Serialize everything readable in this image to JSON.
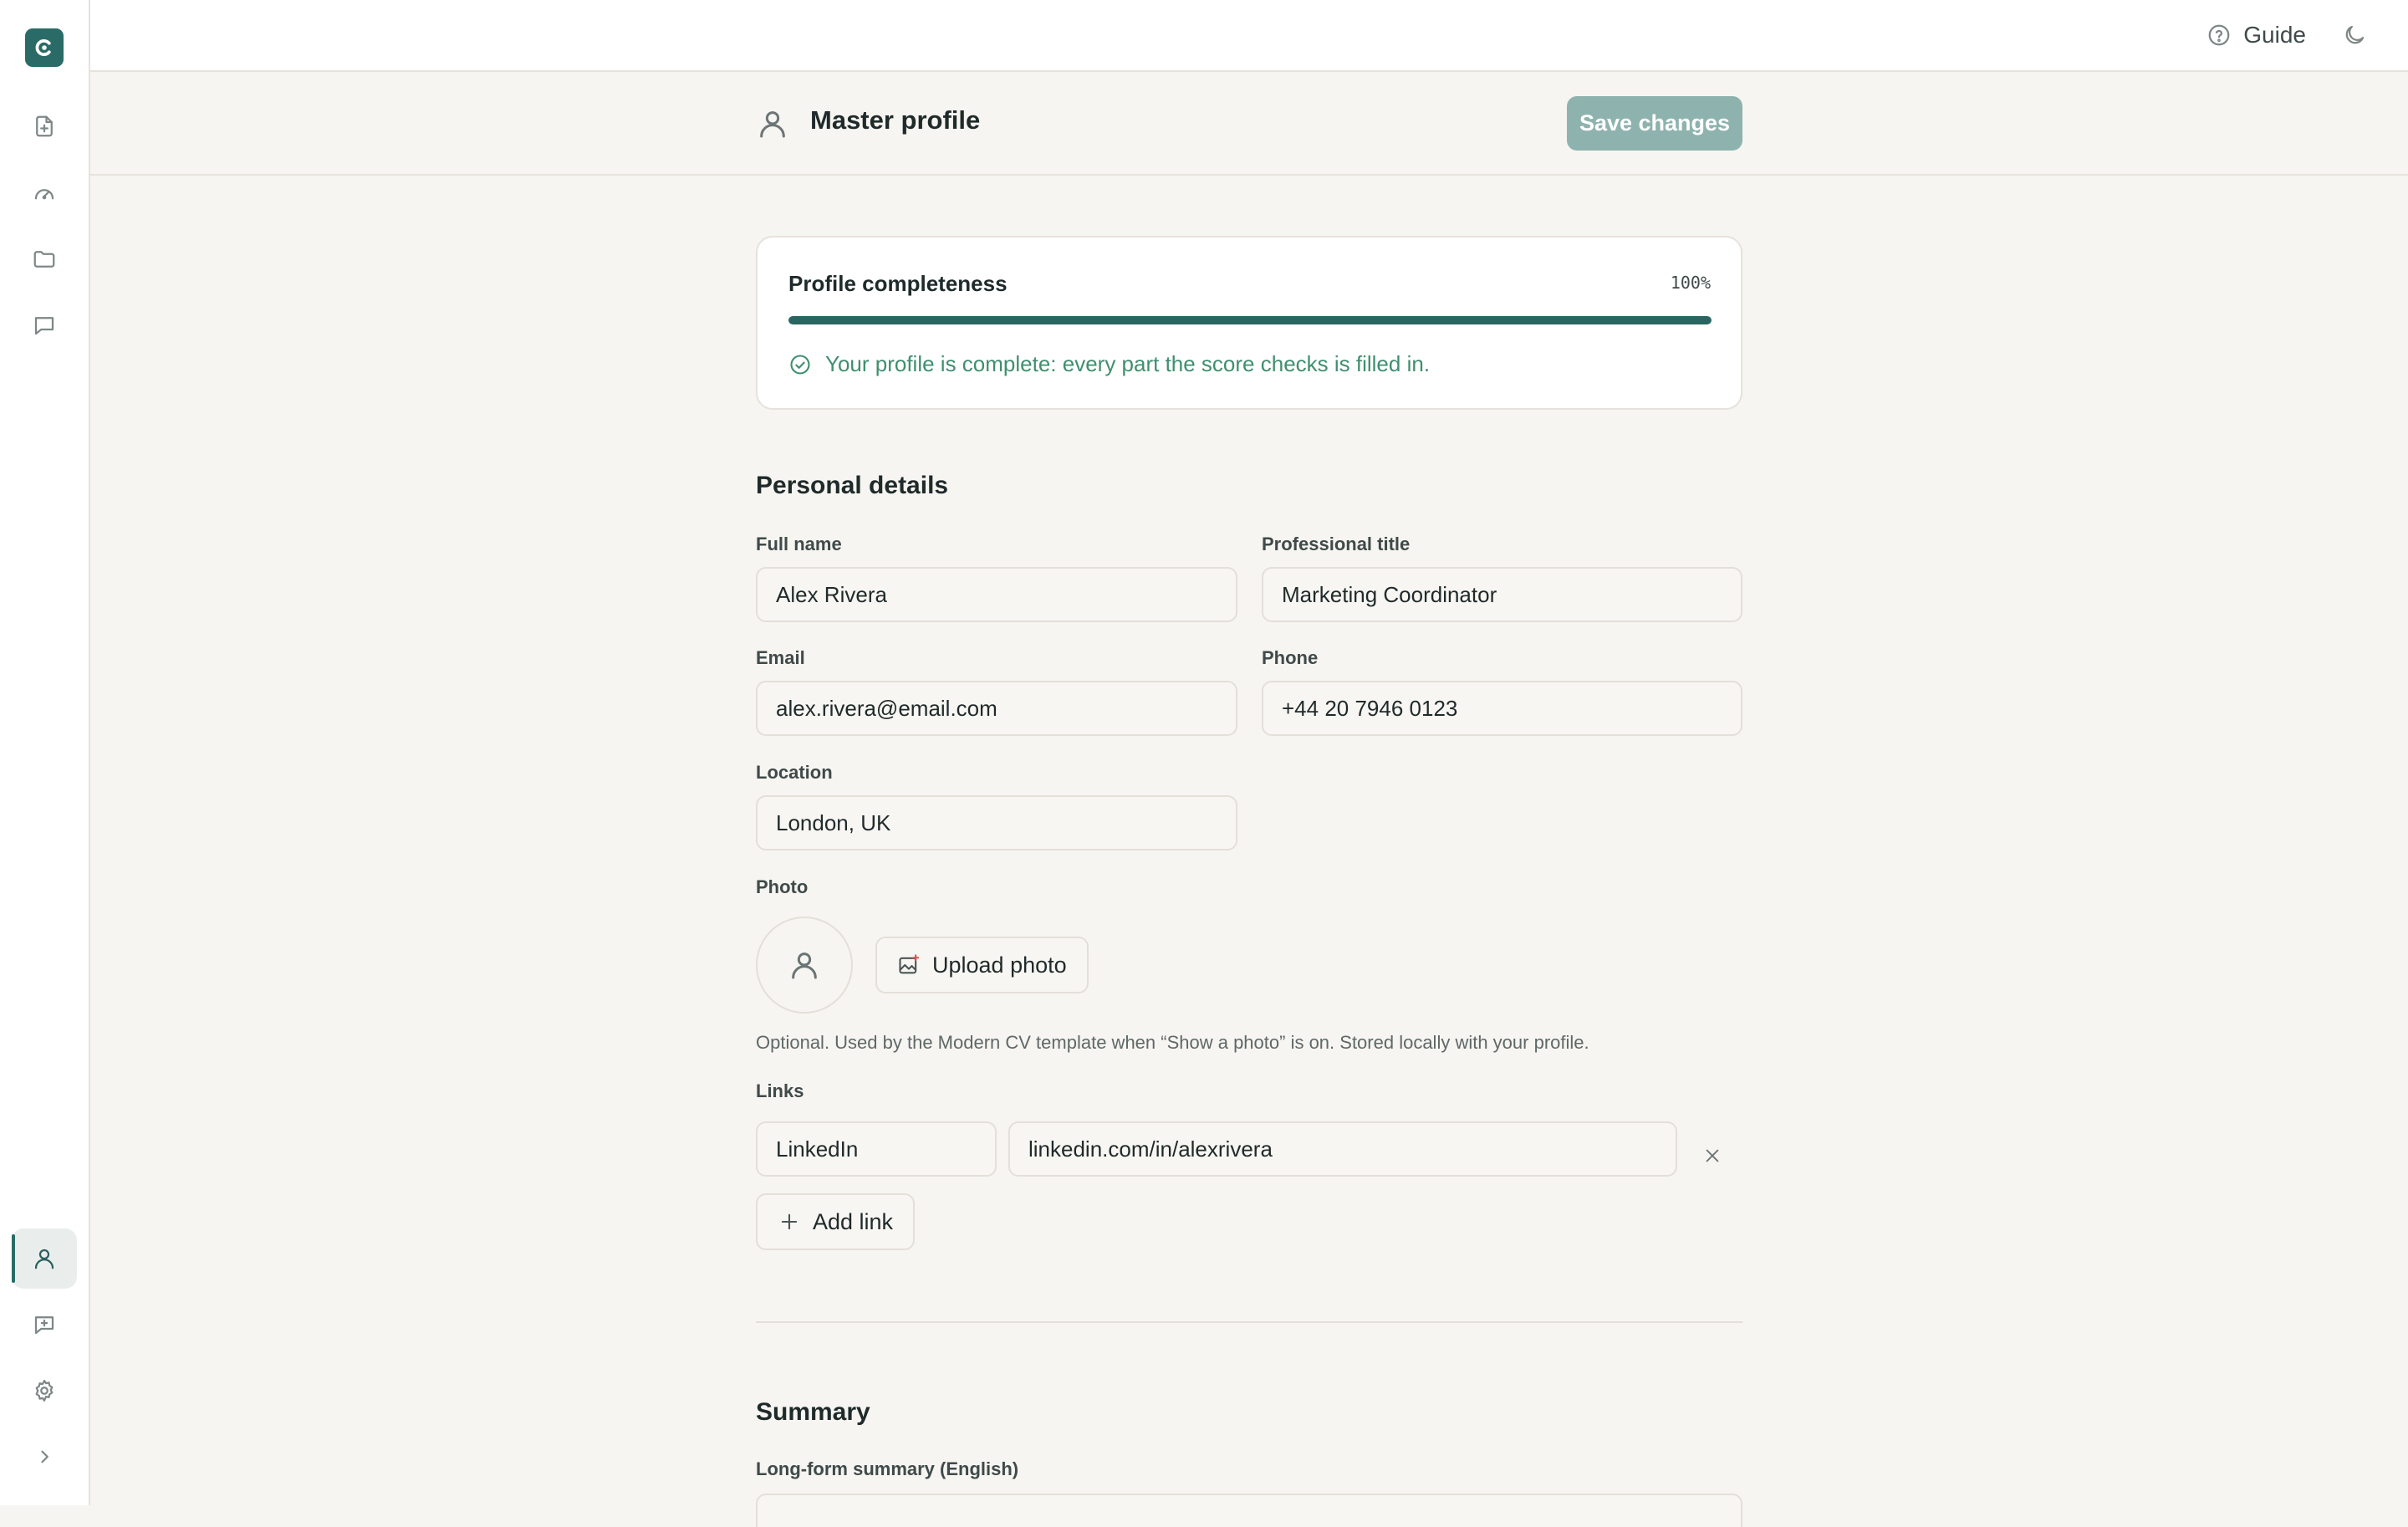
{
  "topbar": {
    "guide_label": "Guide"
  },
  "header": {
    "title": "Master profile",
    "save_label": "Save changes"
  },
  "completeness": {
    "title": "Profile completeness",
    "percent_label": "100%",
    "progress": 1.0,
    "status": "Your profile is complete: every part the score checks is filled in."
  },
  "personal": {
    "title": "Personal details",
    "full_name_label": "Full name",
    "full_name_value": "Alex Rivera",
    "title_label": "Professional title",
    "title_value": "Marketing Coordinator",
    "email_label": "Email",
    "email_value": "alex.rivera@email.com",
    "phone_label": "Phone",
    "phone_value": "+44 20 7946 0123",
    "location_label": "Location",
    "location_value": "London, UK",
    "photo_label": "Photo",
    "upload_label": "Upload photo",
    "photo_hint": "Optional. Used by the Modern CV template when “Show a photo” is on. Stored locally with your profile.",
    "links_label": "Links",
    "links": [
      {
        "name": "LinkedIn",
        "url": "linkedin.com/in/alexrivera"
      }
    ],
    "add_link_label": "Add link"
  },
  "summary": {
    "title": "Summary",
    "long_label": "Long-form summary (English)"
  },
  "colors": {
    "accent": "#2a6b67",
    "success": "#3f8f6f",
    "save_disabled": "#8eb3af"
  }
}
